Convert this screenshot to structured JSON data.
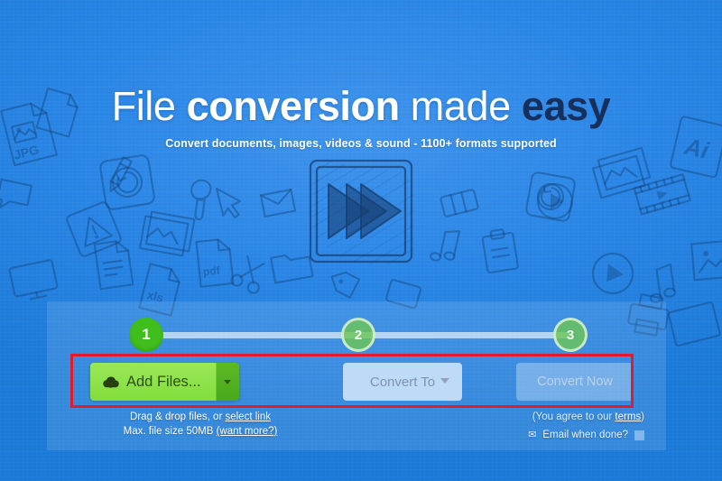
{
  "hero": {
    "headline_part1": "File ",
    "headline_part2": "conversion",
    "headline_part3": " made ",
    "headline_part4": "easy",
    "subhead": "Convert documents, images, videos & sound - 1100+ formats supported"
  },
  "stepper": {
    "step1": "1",
    "step2": "2",
    "step3": "3"
  },
  "controls": {
    "add_files_label": "Add Files...",
    "add_files_icon": "cloud-upload-icon",
    "add_files_caret_icon": "chevron-down-icon",
    "convert_to_label": "Convert To",
    "convert_to_caret_icon": "chevron-down-icon",
    "convert_now_label": "Convert Now"
  },
  "hints": {
    "drag_drop_prefix": "Drag & drop files, or ",
    "select_link": "select link",
    "max_size_prefix": "Max. file size 50MB ",
    "want_more": "(want more?)",
    "terms_prefix": "(You agree to our ",
    "terms_link": "terms",
    "terms_suffix": ")",
    "email_label": "Email when done?",
    "email_icon": "envelope-icon"
  },
  "annotation": {
    "color": "#e01b2c"
  },
  "colors": {
    "background_blue": "#2a86e6",
    "headline_white": "#ffffff",
    "headline_dark": "#16305e",
    "step_active_green": "#3fbe1e",
    "add_files_green": "#8ae234",
    "convert_to_bg": "#dfeefc",
    "annotation_red": "#e01b2c"
  }
}
